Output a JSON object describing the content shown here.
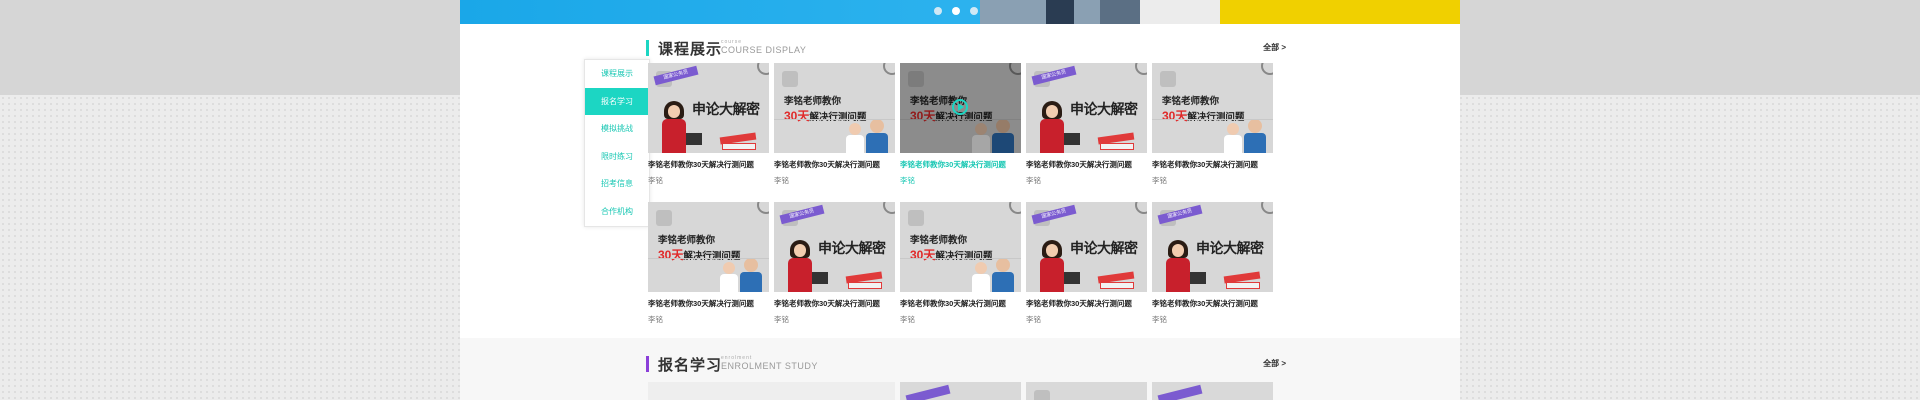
{
  "banner": {
    "slides": [
      "slide-1",
      "slide-2",
      "slide-3"
    ],
    "active_slide": 1,
    "colors": {
      "blue": "#2fb4ef",
      "yellow": "#f0d000"
    }
  },
  "sidebar": {
    "items": [
      {
        "label": "课程展示",
        "active": false
      },
      {
        "label": "报名学习",
        "active": true
      },
      {
        "label": "模拟挑战",
        "active": false
      },
      {
        "label": "限时练习",
        "active": false
      },
      {
        "label": "招考信息",
        "active": false
      },
      {
        "label": "合作机构",
        "active": false
      }
    ],
    "accent_color": "#1cd6c3"
  },
  "course_section": {
    "title": "课程展示",
    "subtitle_small": "course",
    "subtitle": "COURSE DISPLAY",
    "more_label": "全部 >",
    "accent_color": "#1cd6c3",
    "thumb_texts": {
      "a_title": "申论大解密",
      "a_tag": "国家公务员",
      "b_line1": "李铭老师教你",
      "b_days": "30天",
      "b_line2_rest": "解决行测问题"
    },
    "cards": [
      {
        "style": "A",
        "caption": "李铭老师教你30天解决行测问题",
        "teacher": "李铭",
        "hovered": false
      },
      {
        "style": "B",
        "caption": "李铭老师教你30天解决行测问题",
        "teacher": "李铭",
        "hovered": false
      },
      {
        "style": "B",
        "caption": "李铭老师教你30天解决行测问题",
        "teacher": "李铭",
        "hovered": true
      },
      {
        "style": "A",
        "caption": "李铭老师教你30天解决行测问题",
        "teacher": "李铭",
        "hovered": false
      },
      {
        "style": "B",
        "caption": "李铭老师教你30天解决行测问题",
        "teacher": "李铭",
        "hovered": false
      },
      {
        "style": "B",
        "caption": "李铭老师教你30天解决行测问题",
        "teacher": "李铭",
        "hovered": false
      },
      {
        "style": "A",
        "caption": "李铭老师教你30天解决行测问题",
        "teacher": "李铭",
        "hovered": false
      },
      {
        "style": "B",
        "caption": "李铭老师教你30天解决行测问题",
        "teacher": "李铭",
        "hovered": false
      },
      {
        "style": "A",
        "caption": "李铭老师教你30天解决行测问题",
        "teacher": "李铭",
        "hovered": false
      },
      {
        "style": "A",
        "caption": "李铭老师教你30天解决行测问题",
        "teacher": "李铭",
        "hovered": false
      }
    ]
  },
  "enrolment_section": {
    "title": "报名学习",
    "subtitle_small": "enrolment",
    "subtitle": "ENROLMENT STUDY",
    "more_label": "全部 >",
    "accent_color": "#8b3fd9"
  }
}
